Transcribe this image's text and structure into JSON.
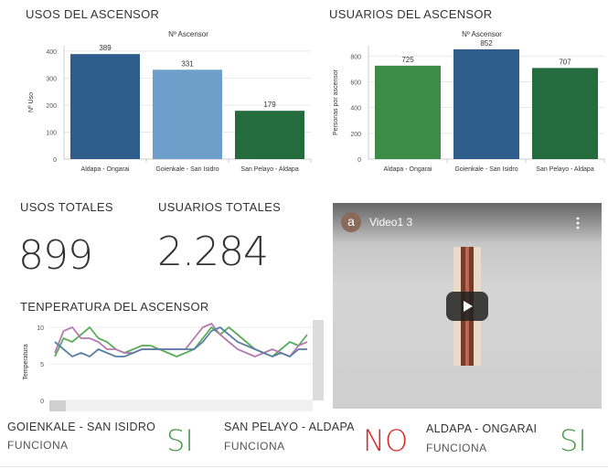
{
  "colors": {
    "dark_blue": "#2e5d8c",
    "light_blue": "#6e9fcb",
    "dark_green": "#246b3e",
    "green": "#3c8c47",
    "line_green": "#5aac58",
    "line_purple": "#b47ab0",
    "line_blue": "#5a7fa6",
    "status_green": "#4c9a4c",
    "status_red": "#d42a2a"
  },
  "usos": {
    "title": "USOS DEL ASCENSOR"
  },
  "usuarios": {
    "title": "USUARIOS DEL ASCENSOR"
  },
  "kpis": {
    "usos_label": "USOS TOTALES",
    "usos_value": "899",
    "usuarios_label": "USUARIOS TOTALES",
    "usuarios_value": "2.284"
  },
  "temperatura": {
    "title": "TENPERATURA DEL ASCENSOR"
  },
  "video": {
    "avatar_letter": "a",
    "title": "Video1 3",
    "menu_icon": "more-vert-icon",
    "play_icon": "play-icon"
  },
  "status": [
    {
      "name": "GOIENKALE - SAN ISIDRO",
      "sub": "FUNCIONA",
      "value": "SI"
    },
    {
      "name": "SAN PELAYO - ALDAPA",
      "sub": "FUNCIONA",
      "value": "NO"
    },
    {
      "name": "ALDAPA - ONGARAI",
      "sub": "FUNCIONA",
      "value": "SI"
    }
  ],
  "chart_data": [
    {
      "type": "bar",
      "title": "Nº Ascensor",
      "ylabel": "Nº Uso",
      "xlabel": "",
      "categories": [
        "Aldapa - Ongarai",
        "Goienkale - San Isidro",
        "San Pelayo - Aldapa"
      ],
      "values": [
        389,
        331,
        179
      ],
      "bar_colors": [
        "#2e5d8c",
        "#6e9fcb",
        "#246b3e"
      ],
      "yticks": [
        0,
        100,
        200,
        300,
        400
      ],
      "ylim": [
        0,
        420
      ],
      "grid": true
    },
    {
      "type": "bar",
      "title": "Nº Ascensor",
      "ylabel": "Personas por ascensor",
      "xlabel": "",
      "categories": [
        "Aldapa - Ongarai",
        "Goienkale - San Isidro",
        "San Pelayo - Aldapa"
      ],
      "values": [
        725,
        852,
        707
      ],
      "bar_colors": [
        "#3c8c47",
        "#2e5d8c",
        "#246b3e"
      ],
      "yticks": [
        0,
        200,
        400,
        600,
        800
      ],
      "ylim": [
        0,
        880
      ],
      "grid": true
    },
    {
      "type": "line",
      "title": "",
      "ylabel": "Temperatura",
      "xlabel": "",
      "yticks": [
        0,
        5,
        10
      ],
      "ylim": [
        0,
        11
      ],
      "grid": true,
      "x": [
        1,
        2,
        3,
        4,
        5,
        6,
        7,
        8,
        9,
        10,
        11,
        12,
        13,
        14,
        15,
        16,
        17,
        18,
        19,
        20,
        21,
        22,
        23,
        24,
        25,
        26,
        27,
        28,
        29,
        30
      ],
      "series": [
        {
          "color": "#5aac58",
          "values": [
            6,
            8.5,
            8,
            9,
            10,
            8.5,
            8,
            7,
            6.5,
            7,
            7.5,
            7.5,
            7,
            6.5,
            6,
            6.5,
            7,
            8.5,
            10,
            9,
            10,
            9,
            8,
            7,
            6.5,
            6,
            7,
            8,
            7.5,
            9
          ]
        },
        {
          "color": "#b47ab0",
          "values": [
            6.5,
            9.5,
            10,
            8.5,
            8.5,
            8,
            7,
            7,
            6.5,
            6.5,
            7,
            7,
            7,
            7,
            7,
            7,
            8.5,
            10,
            10.5,
            9,
            8,
            7,
            6.5,
            6,
            6.5,
            7,
            6.5,
            6,
            7.5,
            8
          ]
        },
        {
          "color": "#5a7fa6",
          "values": [
            8,
            7,
            6,
            6.5,
            6,
            7,
            6.5,
            6,
            6,
            6.5,
            7,
            7,
            7,
            7,
            7,
            7,
            7,
            8,
            9.5,
            10,
            9,
            8,
            7.5,
            7,
            6.5,
            6,
            6.5,
            6,
            7,
            7
          ]
        }
      ]
    }
  ]
}
